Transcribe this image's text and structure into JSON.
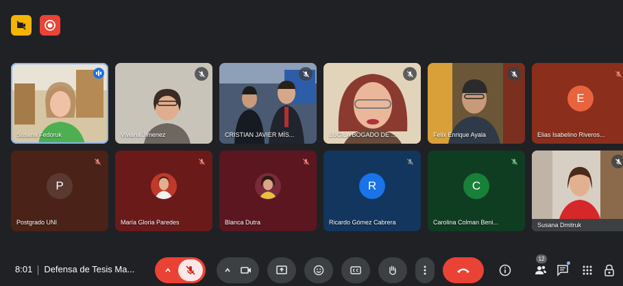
{
  "meeting": {
    "time": "8:01",
    "title": "Defensa de Tesis Ma..."
  },
  "participants": {
    "row1": [
      {
        "name": "Susana Fedoruk",
        "muted": false,
        "speaking": true
      },
      {
        "name": "Viviana Jimenez",
        "muted": true
      },
      {
        "name": "CRISTIAN JAVIER MÍS...",
        "muted": true
      },
      {
        "name": "LUCILA BOGADO DE ...",
        "muted": true
      },
      {
        "name": "Felix Enrique Ayala",
        "muted": true
      },
      {
        "name": "Elias Isabelino Riveros...",
        "initial": "E",
        "muted": true
      }
    ],
    "row2": [
      {
        "name": "Postgrado UNI",
        "initial": "P",
        "muted": true
      },
      {
        "name": "María Gloria Paredes",
        "muted": true
      },
      {
        "name": "Blanca Dutra",
        "muted": true
      },
      {
        "name": "Ricardo Gómez Cabrera",
        "initial": "R",
        "muted": true
      },
      {
        "name": "Carolina Colman Beni...",
        "initial": "C",
        "muted": true
      },
      {
        "name": "Susana Dmitruk",
        "muted": true
      }
    ]
  },
  "controls": {
    "people_count": "12"
  },
  "colors": {
    "background": "#202124",
    "accent_red": "#ea4335",
    "mute_red": "#f28b82",
    "blue": "#1a73e8",
    "green_avatar": "#188038",
    "brown_avatar": "#e8643d"
  }
}
